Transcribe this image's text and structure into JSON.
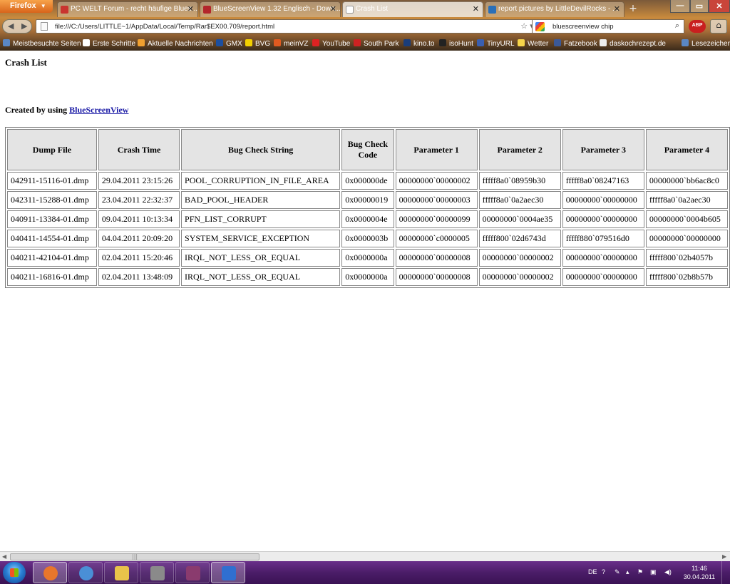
{
  "browser": {
    "app_button": "Firefox",
    "tabs": [
      {
        "label": "PC WELT Forum - recht häufige Blues...",
        "active": false,
        "color": "#c9342f"
      },
      {
        "label": "BlueScreenView 1.32 Englisch - Down...",
        "active": false,
        "color": "#b3262b"
      },
      {
        "label": "Crash List",
        "active": true,
        "color": "#ffffff"
      },
      {
        "label": "report pictures by LittleDevilRocks - ...",
        "active": false,
        "color": "#2a6fb8"
      }
    ],
    "new_tab": "+",
    "window_buttons": [
      "—",
      "▭",
      "✕"
    ],
    "url": "file:///C:/Users/LITTLE~1/AppData/Local/Temp/Rar$EX00.709/report.html",
    "search_query": "bluescreenview chip",
    "bookmarks": [
      "Meistbesuchte Seiten",
      "Erste Schritte",
      "Aktuelle Nachrichten",
      "GMX",
      "BVG",
      "meinVZ",
      "YouTube",
      "South Park",
      "kino.to",
      "isoHunt",
      "TinyURL",
      "Wetter",
      "Fatzebook",
      "daskochrezept.de"
    ],
    "bookmarks_menu": "Lesezeichen"
  },
  "page": {
    "title": "Crash List",
    "created_prefix": "Created by using ",
    "created_link": "BlueScreenView"
  },
  "table": {
    "headers": [
      "Dump File",
      "Crash Time",
      "Bug Check String",
      "Bug Check Code",
      "Parameter 1",
      "Parameter 2",
      "Parameter 3",
      "Parameter 4"
    ],
    "rows": [
      [
        "042911-15116-01.dmp",
        "29.04.2011 23:15:26",
        "POOL_CORRUPTION_IN_FILE_AREA",
        "0x000000de",
        "00000000`00000002",
        "fffff8a0`08959b30",
        "fffff8a0`08247163",
        "00000000`bb6ac8c0"
      ],
      [
        "042311-15288-01.dmp",
        "23.04.2011 22:32:37",
        "BAD_POOL_HEADER",
        "0x00000019",
        "00000000`00000003",
        "fffff8a0`0a2aec30",
        "00000000`00000000",
        "fffff8a0`0a2aec30"
      ],
      [
        "040911-13384-01.dmp",
        "09.04.2011 10:13:34",
        "PFN_LIST_CORRUPT",
        "0x0000004e",
        "00000000`00000099",
        "00000000`0004ae35",
        "00000000`00000000",
        "00000000`0004b605"
      ],
      [
        "040411-14554-01.dmp",
        "04.04.2011 20:09:20",
        "SYSTEM_SERVICE_EXCEPTION",
        "0x0000003b",
        "00000000`c0000005",
        "fffff800`02d6743d",
        "fffff880`079516d0",
        "00000000`00000000"
      ],
      [
        "040211-42104-01.dmp",
        "02.04.2011 15:20:46",
        "IRQL_NOT_LESS_OR_EQUAL",
        "0x0000000a",
        "00000000`00000008",
        "00000000`00000002",
        "00000000`00000000",
        "fffff800`02b4057b"
      ],
      [
        "040211-16816-01.dmp",
        "02.04.2011 13:48:09",
        "IRQL_NOT_LESS_OR_EQUAL",
        "0x0000000a",
        "00000000`00000008",
        "00000000`00000002",
        "00000000`00000000",
        "fffff800`02b8b57b"
      ]
    ]
  },
  "taskbar": {
    "apps": [
      {
        "name": "firefox",
        "color": "#e8762b",
        "active": true
      },
      {
        "name": "itunes",
        "color": "#4a8fd6",
        "active": false
      },
      {
        "name": "explorer",
        "color": "#e8c34a",
        "active": false
      },
      {
        "name": "tools",
        "color": "#8a8a8a",
        "active": false
      },
      {
        "name": "winrar",
        "color": "#8a3b6e",
        "active": false
      },
      {
        "name": "bluescreenview",
        "color": "#2f6fd0",
        "active": true
      }
    ],
    "language": "DE",
    "time": "11:46",
    "date": "30.04.2011"
  }
}
